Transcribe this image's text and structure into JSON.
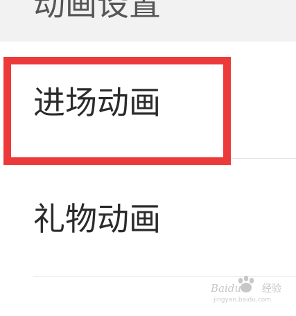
{
  "section_header": {
    "label": "动画设置"
  },
  "list": {
    "items": [
      {
        "label": "进场动画",
        "highlighted": true
      },
      {
        "label": "礼物动画",
        "highlighted": false
      }
    ]
  },
  "highlight": {
    "color": "#ec3a3a"
  },
  "watermark": {
    "brand": "Baidu",
    "product": "经验",
    "domain": "jingyan.baidu.com",
    "icon": "baidu-paw-icon"
  }
}
